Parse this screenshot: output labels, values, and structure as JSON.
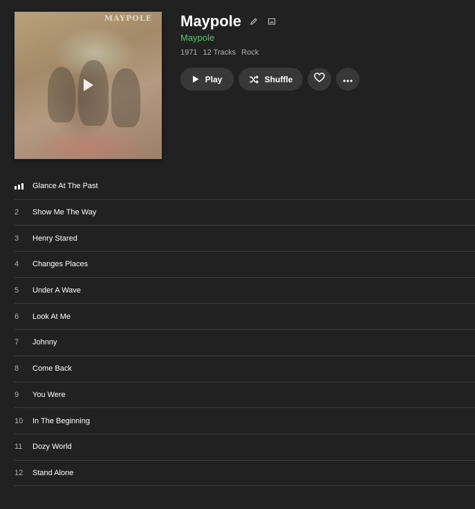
{
  "album": {
    "title": "Maypole",
    "artist": "Maypole",
    "year": "1971",
    "track_count": "12 Tracks",
    "genre": "Rock",
    "cover_text": "MAYPOLE"
  },
  "actions": {
    "play_label": "Play",
    "shuffle_label": "Shuffle"
  },
  "colors": {
    "background": "#212121",
    "accent": "#5fc36a",
    "button_bg": "#383838"
  },
  "tracks": [
    {
      "num": "1",
      "title": "Glance At The Past",
      "playing": true
    },
    {
      "num": "2",
      "title": "Show Me The Way"
    },
    {
      "num": "3",
      "title": "Henry Stared"
    },
    {
      "num": "4",
      "title": "Changes Places"
    },
    {
      "num": "5",
      "title": "Under A Wave"
    },
    {
      "num": "6",
      "title": "Look At Me"
    },
    {
      "num": "7",
      "title": "Johnny"
    },
    {
      "num": "8",
      "title": "Come Back"
    },
    {
      "num": "9",
      "title": "You Were"
    },
    {
      "num": "10",
      "title": "In The Beginning"
    },
    {
      "num": "11",
      "title": "Dozy World"
    },
    {
      "num": "12",
      "title": "Stand Alone"
    }
  ]
}
